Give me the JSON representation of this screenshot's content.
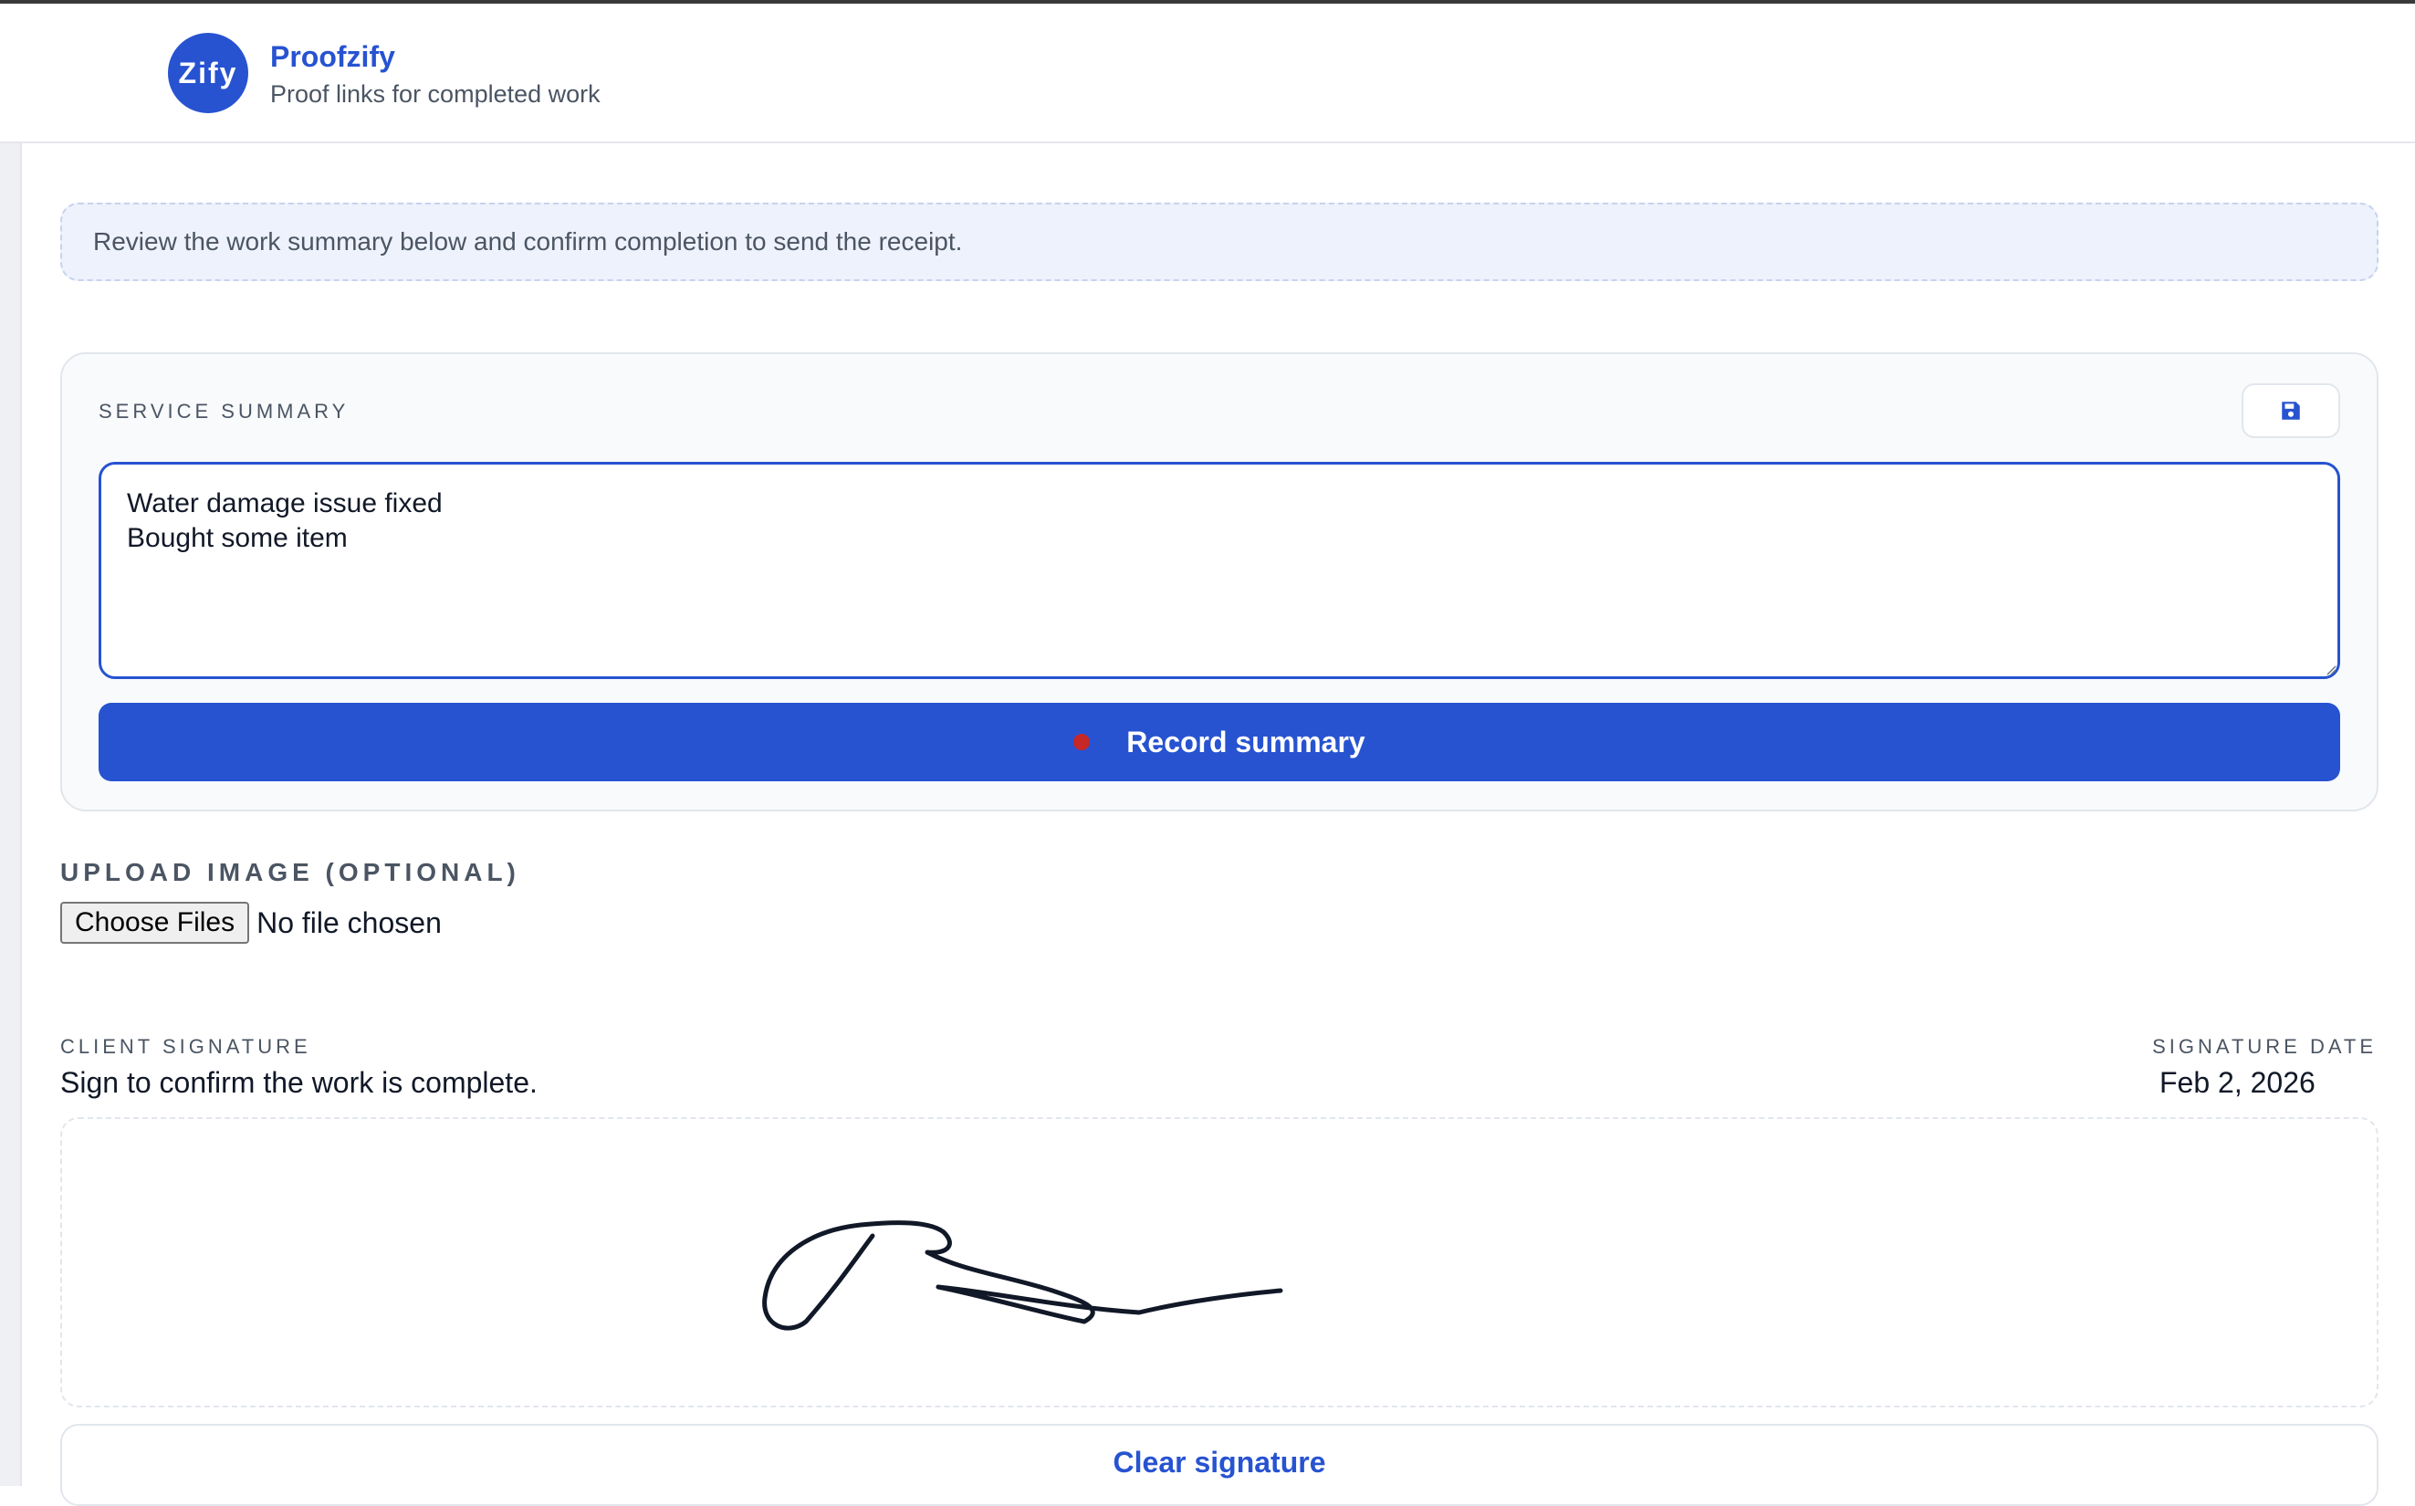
{
  "brand": {
    "logo_text": "Zify",
    "name": "Proofzify",
    "tagline": "Proof links for completed work"
  },
  "notice": {
    "text": "Review the work summary below and confirm completion to send the receipt."
  },
  "service_summary": {
    "title": "SERVICE SUMMARY",
    "save_icon": "save-icon",
    "text": "Water damage issue fixed\nBought some item",
    "record_button_label": "Record summary"
  },
  "upload": {
    "label": "UPLOAD IMAGE (OPTIONAL)",
    "choose_button": "Choose Files",
    "status": "No file chosen"
  },
  "signature": {
    "label": "CLIENT SIGNATURE",
    "help": "Sign to confirm the work is complete.",
    "date_label": "SIGNATURE DATE",
    "date": "Feb 2, 2026",
    "clear_button": "Clear signature"
  },
  "colors": {
    "accent": "#2753d1",
    "record_dot": "#c62828",
    "notice_bg": "#eef2fc"
  }
}
